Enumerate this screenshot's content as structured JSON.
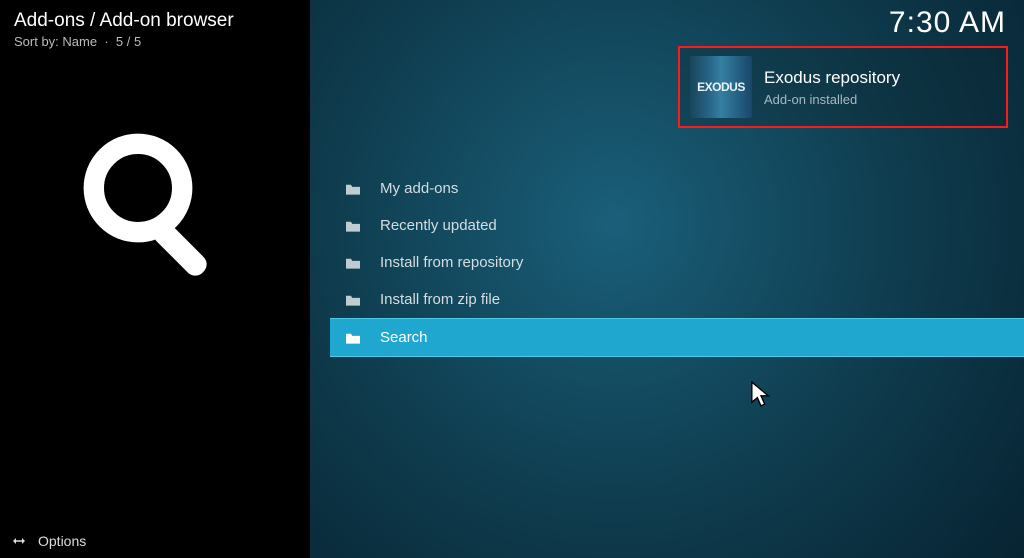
{
  "header": {
    "breadcrumb": "Add-ons / Add-on browser",
    "sort_label": "Sort by: Name",
    "sort_sep": "·",
    "count": "5 / 5"
  },
  "clock": "7:30 AM",
  "big_icon_name": "search",
  "menu": {
    "items": [
      {
        "label": "My add-ons",
        "icon": "folder",
        "selected": false
      },
      {
        "label": "Recently updated",
        "icon": "folder",
        "selected": false
      },
      {
        "label": "Install from repository",
        "icon": "folder",
        "selected": false
      },
      {
        "label": "Install from zip file",
        "icon": "folder",
        "selected": false
      },
      {
        "label": "Search",
        "icon": "folder",
        "selected": true
      }
    ]
  },
  "notification": {
    "thumb_text": "EXODUS",
    "title": "Exodus repository",
    "subtitle": "Add-on installed"
  },
  "footer": {
    "options_label": "Options"
  }
}
